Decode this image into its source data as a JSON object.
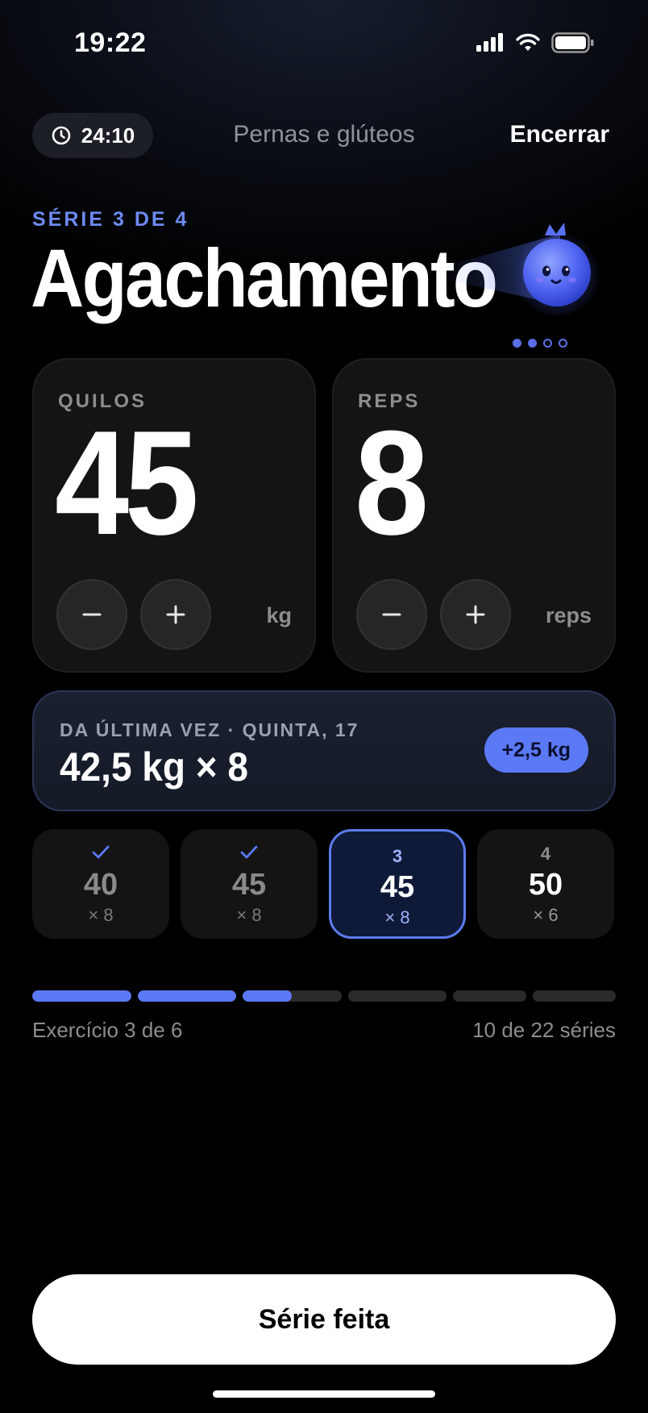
{
  "status_bar": {
    "time": "19:22"
  },
  "top_bar": {
    "timer": "24:10",
    "workout_name": "Pernas e glúteos",
    "end_label": "Encerrar"
  },
  "exercise": {
    "set_label": "SÉRIE 3 DE 4",
    "name": "Agachamento",
    "page_dots": {
      "count": 4,
      "active": [
        1,
        2
      ]
    }
  },
  "weight_card": {
    "label": "QUILOS",
    "value": "45",
    "unit": "kg"
  },
  "reps_card": {
    "label": "REPS",
    "value": "8",
    "unit": "reps"
  },
  "last_time": {
    "label": "DA ÚLTIMA VEZ · QUINTA, 17",
    "value": "42,5 kg × 8",
    "delta": "+2,5 kg"
  },
  "sets": [
    {
      "marker": "",
      "completed": true,
      "weight": "40",
      "reps": "× 8",
      "state": "done"
    },
    {
      "marker": "",
      "completed": true,
      "weight": "45",
      "reps": "× 8",
      "state": "done"
    },
    {
      "marker": "3",
      "completed": false,
      "weight": "45",
      "reps": "× 8",
      "state": "active"
    },
    {
      "marker": "4",
      "completed": false,
      "weight": "50",
      "reps": "× 6",
      "state": "upcoming"
    }
  ],
  "progress": {
    "exercise_label": "Exercício 3 de 6",
    "sets_label": "10 de 22 séries",
    "segments": [
      1,
      1,
      0.5,
      0,
      0,
      0
    ]
  },
  "cta": {
    "label": "Série feita"
  },
  "colors": {
    "accent": "#5b78f5",
    "background": "#000000",
    "card": "#141414"
  },
  "icons": {
    "timer": "clock-icon",
    "signal": "cellular-signal-icon",
    "wifi": "wifi-icon",
    "battery": "battery-icon",
    "minus": "minus-icon",
    "plus": "plus-icon",
    "check": "checkmark-icon",
    "mascot": "blue-blob-mascot"
  }
}
